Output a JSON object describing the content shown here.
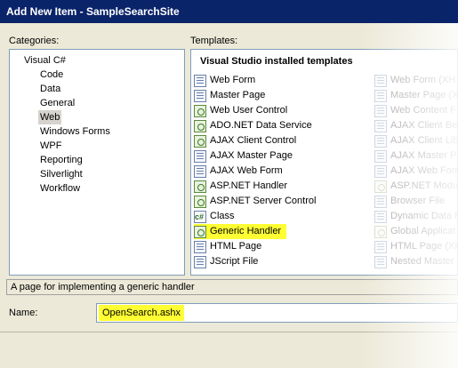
{
  "window": {
    "title": "Add New Item - SampleSearchSite"
  },
  "categories": {
    "label": "Categories:",
    "items": [
      {
        "label": "Visual C#",
        "indent": 0,
        "selected": false
      },
      {
        "label": "Code",
        "indent": 1,
        "selected": false
      },
      {
        "label": "Data",
        "indent": 1,
        "selected": false
      },
      {
        "label": "General",
        "indent": 1,
        "selected": false
      },
      {
        "label": "Web",
        "indent": 1,
        "selected": true
      },
      {
        "label": "Windows Forms",
        "indent": 1,
        "selected": false
      },
      {
        "label": "WPF",
        "indent": 1,
        "selected": false
      },
      {
        "label": "Reporting",
        "indent": 1,
        "selected": false
      },
      {
        "label": "Silverlight",
        "indent": 1,
        "selected": false
      },
      {
        "label": "Workflow",
        "indent": 1,
        "selected": false
      }
    ]
  },
  "templates": {
    "label": "Templates:",
    "header": "Visual Studio installed templates",
    "left_column": [
      {
        "label": "Web Form",
        "icon": "web-form-icon",
        "highlight": false
      },
      {
        "label": "Master Page",
        "icon": "master-page-icon",
        "highlight": false
      },
      {
        "label": "Web User Control",
        "icon": "web-user-control-icon",
        "highlight": false
      },
      {
        "label": "ADO.NET Data Service",
        "icon": "data-service-icon",
        "highlight": false
      },
      {
        "label": "AJAX Client Control",
        "icon": "ajax-client-control-icon",
        "highlight": false
      },
      {
        "label": "AJAX Master Page",
        "icon": "ajax-master-page-icon",
        "highlight": false
      },
      {
        "label": "AJAX Web Form",
        "icon": "ajax-web-form-icon",
        "highlight": false
      },
      {
        "label": "ASP.NET Handler",
        "icon": "aspnet-handler-icon",
        "highlight": false
      },
      {
        "label": "ASP.NET Server Control",
        "icon": "server-control-icon",
        "highlight": false
      },
      {
        "label": "Class",
        "icon": "class-icon",
        "highlight": false
      },
      {
        "label": "Generic Handler",
        "icon": "generic-handler-icon",
        "highlight": true
      },
      {
        "label": "HTML Page",
        "icon": "html-page-icon",
        "highlight": false
      },
      {
        "label": "JScript File",
        "icon": "jscript-file-icon",
        "highlight": false
      }
    ],
    "right_column": [
      {
        "label": "Web Form (XH",
        "icon": "web-form-xhtml-icon"
      },
      {
        "label": "Master Page (X",
        "icon": "master-page-xhtml-icon"
      },
      {
        "label": "Web Content F",
        "icon": "web-content-form-icon"
      },
      {
        "label": "AJAX Client Be",
        "icon": "ajax-client-behavior-icon"
      },
      {
        "label": "AJAX Client Lib",
        "icon": "ajax-client-library-icon"
      },
      {
        "label": "AJAX Master Pa",
        "icon": "ajax-master-page-2-icon"
      },
      {
        "label": "AJAX Web Form",
        "icon": "ajax-web-form-2-icon"
      },
      {
        "label": "ASP.NET Modul",
        "icon": "aspnet-module-icon"
      },
      {
        "label": "Browser File",
        "icon": "browser-file-icon"
      },
      {
        "label": "Dynamic Data F",
        "icon": "dynamic-data-icon"
      },
      {
        "label": "Global Applicat",
        "icon": "global-application-icon"
      },
      {
        "label": "HTML Page (XH",
        "icon": "html-page-xhtml-icon"
      },
      {
        "label": "Nested Master",
        "icon": "nested-master-icon"
      }
    ]
  },
  "description": "A page for implementing a generic handler",
  "name_field": {
    "label": "Name:",
    "value": "OpenSearch.ashx"
  },
  "colors": {
    "highlight": "#ffff33",
    "titlebar": "#0a246a",
    "dialog_background": "#ece9d8"
  }
}
